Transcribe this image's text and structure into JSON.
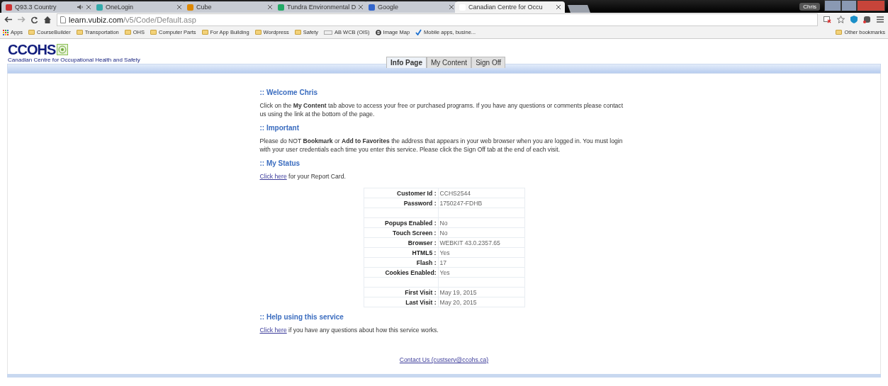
{
  "browser": {
    "tabs": [
      {
        "title": "Q93.3 Country",
        "audio": true,
        "selected": false
      },
      {
        "title": "OneLogin",
        "audio": false,
        "selected": false
      },
      {
        "title": "Cube",
        "audio": false,
        "selected": false
      },
      {
        "title": "Tundra Environmental D",
        "audio": false,
        "selected": false
      },
      {
        "title": "Google",
        "audio": false,
        "selected": false
      },
      {
        "title": "Canadian Centre for Occu",
        "audio": false,
        "selected": true
      }
    ],
    "user": "Chris",
    "url_host": "learn.vubiz.com",
    "url_path": "/v5/Code/Default.asp",
    "bookmarks": [
      {
        "label": "Apps",
        "kind": "apps"
      },
      {
        "label": "CourseBuilder",
        "kind": "folder"
      },
      {
        "label": "Transportation",
        "kind": "folder"
      },
      {
        "label": "OHS",
        "kind": "folder"
      },
      {
        "label": "Computer Parts",
        "kind": "folder"
      },
      {
        "label": "For App Building",
        "kind": "folder"
      },
      {
        "label": "Wordpress",
        "kind": "folder"
      },
      {
        "label": "Safety",
        "kind": "folder"
      },
      {
        "label": "AB WCB (OIS)",
        "kind": "page"
      },
      {
        "label": "Image Map",
        "kind": "ie"
      },
      {
        "label": "Mobile apps, busine...",
        "kind": "check"
      }
    ],
    "other_bookmarks": "Other bookmarks"
  },
  "site": {
    "logo": "CCOHS",
    "logo_subtitle": "Canadian Centre for Occupational Health and Safety",
    "tabs": [
      {
        "label": "Info Page",
        "selected": true
      },
      {
        "label": "My Content",
        "selected": false
      },
      {
        "label": "Sign Off",
        "selected": false
      }
    ]
  },
  "sections": [
    {
      "heading": ":: Welcome Chris",
      "kind": "text",
      "text": "Click on the **My Content** tab above to access your free or purchased programs.  If you have any questions or comments please contact us using the link at the bottom of the page."
    },
    {
      "heading": ":: Important",
      "kind": "text",
      "text": "Please do NOT **Bookmark** or **Add to Favorites** the address that appears in your web browser when you are logged in. You must login with your user credentials each time you enter this service. Please click the Sign Off tab at the end of each visit."
    },
    {
      "heading": ":: My Status",
      "kind": "link",
      "link": "Click here",
      "text": " for your Report Card."
    },
    {
      "kind": "table",
      "rows": [
        {
          "label": "Customer Id :",
          "value": "CCHS2544"
        },
        {
          "label": "Password :",
          "value": "1750247-FDHB"
        },
        {
          "label": "",
          "value": ""
        },
        {
          "label": "Popups Enabled :",
          "value": "No"
        },
        {
          "label": "Touch Screen :",
          "value": "No"
        },
        {
          "label": "Browser :",
          "value": "WEBKIT 43.0.2357.65"
        },
        {
          "label": "HTML5 :",
          "value": "Yes"
        },
        {
          "label": "Flash :",
          "value": "17"
        },
        {
          "label": "Cookies Enabled:",
          "value": "Yes"
        },
        {
          "label": "",
          "value": ""
        },
        {
          "label": "First Visit :",
          "value": "May 19, 2015"
        },
        {
          "label": "Last Visit :",
          "value": "May 20, 2015"
        }
      ]
    },
    {
      "heading": ":: Help using this service",
      "kind": "link",
      "link": "Click here",
      "text": " if you have any questions about how this service works."
    }
  ],
  "contact": "Contact Us (custserv@ccohs.ca)"
}
